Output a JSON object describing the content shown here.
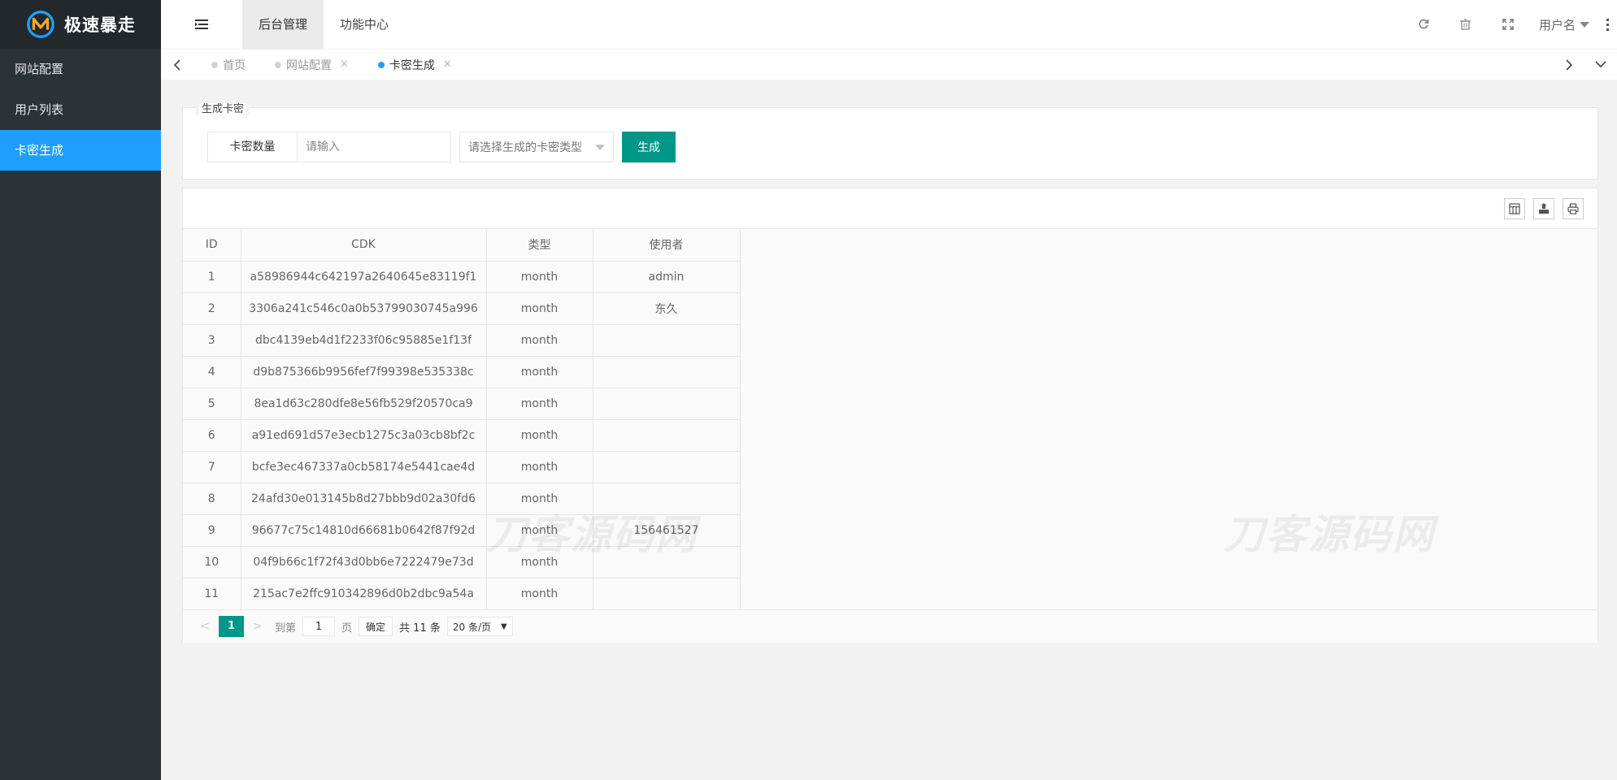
{
  "app": {
    "name": "极速暴走"
  },
  "sidebar": {
    "items": [
      {
        "label": "网站配置"
      },
      {
        "label": "用户列表"
      },
      {
        "label": "卡密生成"
      }
    ]
  },
  "header": {
    "tabs": [
      {
        "label": "后台管理"
      },
      {
        "label": "功能中心"
      }
    ],
    "user_name": "用户名"
  },
  "page_tabs": [
    {
      "label": "首页"
    },
    {
      "label": "网站配置"
    },
    {
      "label": "卡密生成"
    }
  ],
  "generator": {
    "legend": "生成卡密",
    "quantity_label": "卡密数量",
    "quantity_placeholder": "请输入",
    "type_placeholder": "请选择生成的卡密类型",
    "submit_label": "生成"
  },
  "table": {
    "columns": [
      "ID",
      "CDK",
      "类型",
      "使用者"
    ],
    "rows": [
      {
        "id": "1",
        "cdk": "a58986944c642197a2640645e83119f1",
        "type": "month",
        "user": "admin"
      },
      {
        "id": "2",
        "cdk": "3306a241c546c0a0b53799030745a996",
        "type": "month",
        "user": "东久"
      },
      {
        "id": "3",
        "cdk": "dbc4139eb4d1f2233f06c95885e1f13f",
        "type": "month",
        "user": ""
      },
      {
        "id": "4",
        "cdk": "d9b875366b9956fef7f99398e535338c",
        "type": "month",
        "user": ""
      },
      {
        "id": "5",
        "cdk": "8ea1d63c280dfe8e56fb529f20570ca9",
        "type": "month",
        "user": ""
      },
      {
        "id": "6",
        "cdk": "a91ed691d57e3ecb1275c3a03cb8bf2c",
        "type": "month",
        "user": ""
      },
      {
        "id": "7",
        "cdk": "bcfe3ec467337a0cb58174e5441cae4d",
        "type": "month",
        "user": ""
      },
      {
        "id": "8",
        "cdk": "24afd30e013145b8d27bbb9d02a30fd6",
        "type": "month",
        "user": ""
      },
      {
        "id": "9",
        "cdk": "96677c75c14810d66681b0642f87f92d",
        "type": "month",
        "user": "156461527"
      },
      {
        "id": "10",
        "cdk": "04f9b66c1f72f43d0bb6e7222479e73d",
        "type": "month",
        "user": ""
      },
      {
        "id": "11",
        "cdk": "215ac7e2ffc910342896d0b2dbc9a54a",
        "type": "month",
        "user": ""
      }
    ]
  },
  "pager": {
    "current": "1",
    "goto_label": "到第",
    "page_value": "1",
    "page_unit": "页",
    "confirm_label": "确定",
    "total": "共 11 条",
    "page_size": "20 条/页"
  },
  "watermark": "刀客源码网",
  "colors": {
    "accent": "#009688",
    "active_menu": "#1e9fff",
    "sidebar": "#2b3238"
  }
}
